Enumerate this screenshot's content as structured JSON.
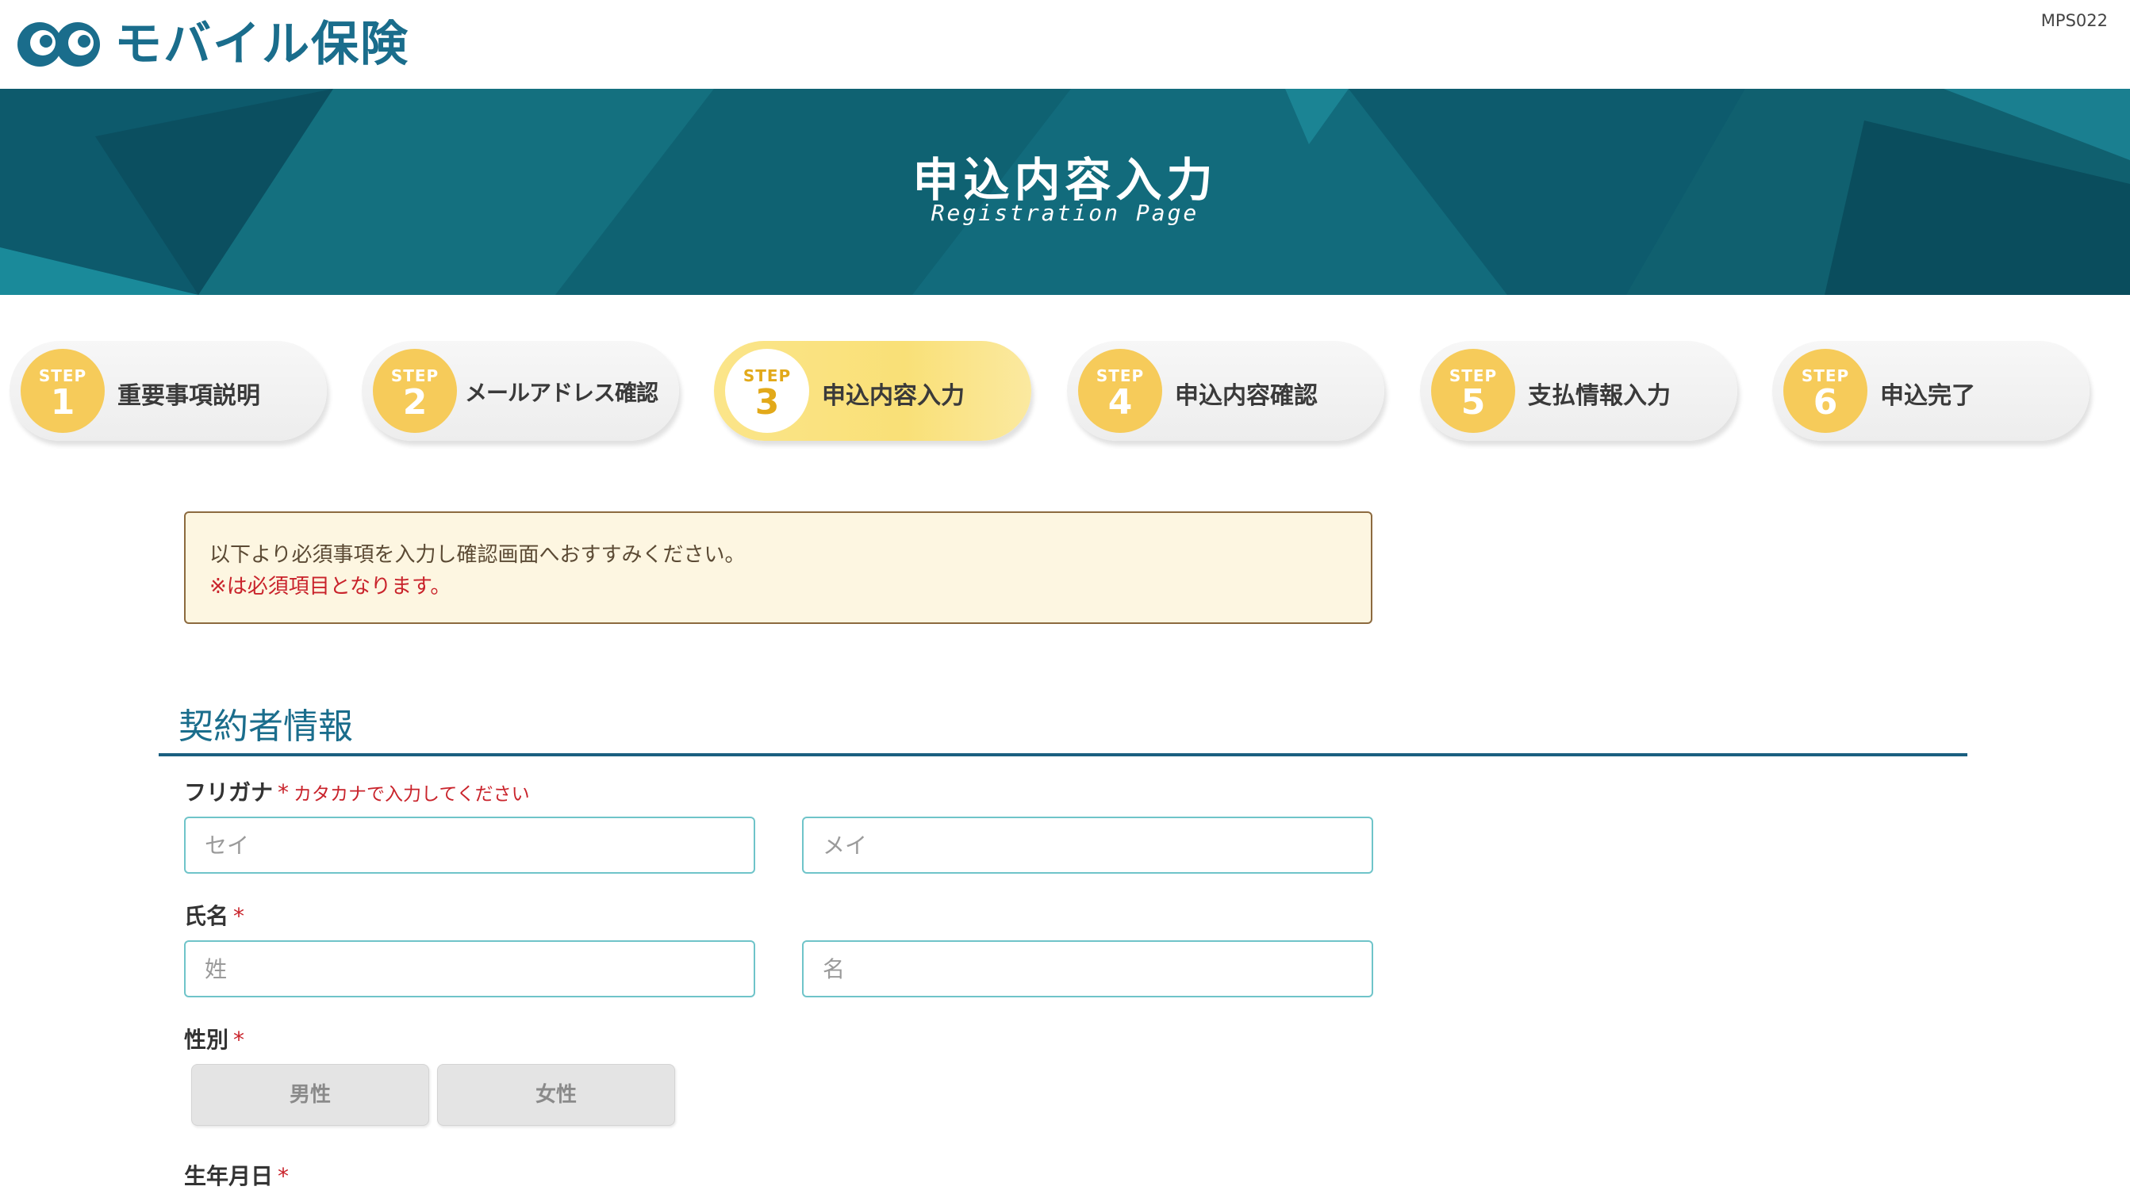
{
  "header": {
    "brand": "モバイル保険",
    "screen_id": "MPS022"
  },
  "banner": {
    "title": "申込内容入力",
    "subtitle": "Registration Page"
  },
  "steps": [
    {
      "step": "STEP",
      "num": "1",
      "label": "重要事項説明"
    },
    {
      "step": "STEP",
      "num": "2",
      "label": "メールアドレス確認"
    },
    {
      "step": "STEP",
      "num": "3",
      "label": "申込内容入力"
    },
    {
      "step": "STEP",
      "num": "4",
      "label": "申込内容確認"
    },
    {
      "step": "STEP",
      "num": "5",
      "label": "支払情報入力"
    },
    {
      "step": "STEP",
      "num": "6",
      "label": "申込完了"
    }
  ],
  "notice": {
    "line1": "以下より必須事項を入力し確認画面へおすすみください。",
    "line2": "※は必須項目となります。"
  },
  "section": {
    "title": "契約者情報"
  },
  "form": {
    "furigana": {
      "label": "フリガナ",
      "required": "*",
      "hint": "カタカナで入力してください",
      "sei_placeholder": "セイ",
      "mei_placeholder": "メイ"
    },
    "name": {
      "label": "氏名",
      "required": "*",
      "last_placeholder": "姓",
      "first_placeholder": "名"
    },
    "gender": {
      "label": "性別",
      "required": "*",
      "male": "男性",
      "female": "女性"
    },
    "birthdate": {
      "label": "生年月日",
      "required": "*"
    }
  }
}
